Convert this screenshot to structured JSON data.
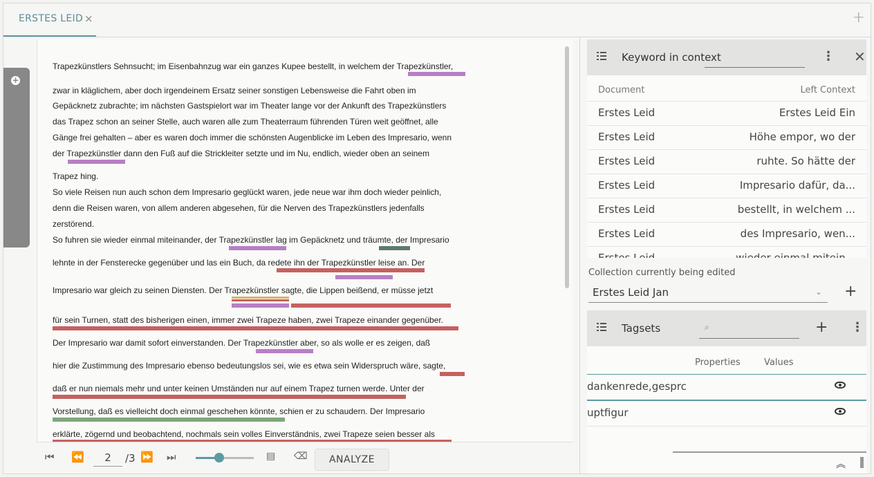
{
  "tab": {
    "title": "ERSTES LEID",
    "close": "×",
    "add": "+"
  },
  "document": {
    "lines": [
      "Trapezkünstlers Sehnsucht; im Eisenbahnzug war ein ganzes Kupee bestellt, in welchem der Trapezkünstler,",
      "zwar in kläglichem, aber doch irgendeinem Ersatz seiner sonstigen Lebensweise die Fahrt oben im",
      "Gepäcknetz zubrachte; im nächsten Gastspielort war im Theater lange vor der Ankunft des Trapezkünstlers",
      "das Trapez schon an seiner Stelle, auch waren alle zum Theaterraum führenden Türen weit geöffnet, alle",
      "Gänge frei gehalten – aber es waren doch immer die schönsten Augenblicke im Leben des Impresario, wenn",
      "der Trapezkünstler dann den Fuß auf die Strickleiter setzte und im Nu, endlich, wieder oben an seinem",
      "Trapez hing.",
      "So viele Reisen nun auch schon dem Impresario geglückt waren, jede neue war ihm doch wieder peinlich,",
      "denn die Reisen waren, von allem anderen abgesehen, für die Nerven des Trapezkünstlers jedenfalls",
      "zerstörend.",
      "So fuhren sie wieder einmal miteinander, der Trapezkünstler lag im Gepäcknetz und träumte, der Impresario",
      " lehnte in der Fensterecke gegenüber und las ein Buch, da redete ihn der Trapezkünstler leise an. Der",
      "Impresario war gleich zu seinen Diensten. Der Trapezkünstler sagte, die Lippen beißend, er müsse jetzt",
      "für sein Turnen, statt des bisherigen einen, immer zwei Trapeze haben, zwei Trapeze einander gegenüber.",
      "Der Impresario war damit sofort einverstanden. Der Trapezkünstler aber, so als wolle er es zeigen, daß",
      "hier die Zustimmung des Impresario ebenso bedeutungslos sei, wie es etwa sein Widerspruch wäre, sagte,",
      "daß er nun niemals mehr und unter keinen Umständen nur auf einem Trapez turnen werde. Unter der",
      "Vorstellung, daß es vielleicht doch einmal geschehen könnte, schien er zu schaudern. Der Impresario",
      "erklärte, zögernd und beobachtend, nochmals sein volles Einverständnis, zwei Trapeze seien besser als"
    ]
  },
  "toolbar": {
    "first_icon": "⏮",
    "prev_icon": "⏪",
    "page": "2",
    "total": "/3",
    "next_icon": "⏩",
    "last_icon": "⏭",
    "zoom_level": 0.4,
    "analyze_label": "ANALYZE"
  },
  "kwic": {
    "title": "Keyword in context",
    "col_document": "Document",
    "col_left_context": "Left Context",
    "rows": [
      {
        "doc": "Erstes Leid",
        "ctx": "Erstes Leid Ein"
      },
      {
        "doc": "Erstes Leid",
        "ctx": "Höhe empor, wo der"
      },
      {
        "doc": "Erstes Leid",
        "ctx": "ruhte. So hätte der"
      },
      {
        "doc": "Erstes Leid",
        "ctx": "Impresario dafür, da..."
      },
      {
        "doc": "Erstes Leid",
        "ctx": "bestellt, in welchem ..."
      },
      {
        "doc": "Erstes Leid",
        "ctx": "des Impresario, wen..."
      },
      {
        "doc": "Erstes Leid",
        "ctx": "wieder einmal mitein..."
      }
    ]
  },
  "collection": {
    "label": "Collection currently being edited",
    "value": "Erstes Leid Jan",
    "add": "+"
  },
  "tagsets": {
    "title": "Tagsets",
    "search_icon": "⌕",
    "add": "+",
    "col_properties": "Properties",
    "col_values": "Values",
    "rows": [
      {
        "name": "dankenrede,gesprc"
      },
      {
        "name": "uptfigur"
      }
    ]
  },
  "colors": {
    "accent": "#5c9aa3",
    "purple": "#b77fc6",
    "red": "#c56260",
    "green": "#7fa77b",
    "dark_green": "#5b7b71",
    "orange": "#d9b36b"
  }
}
